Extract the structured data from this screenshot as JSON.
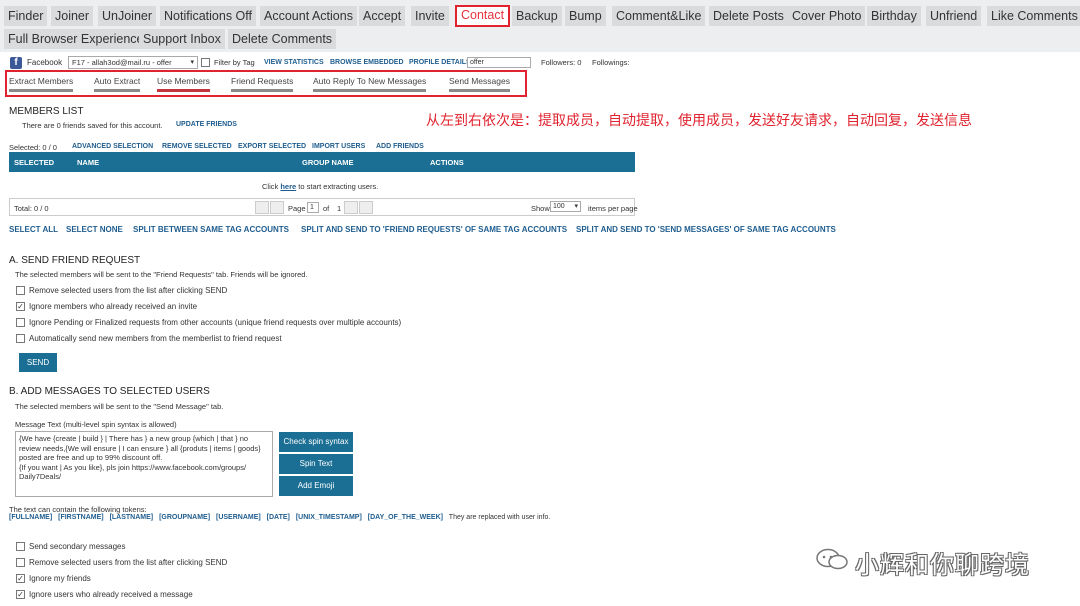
{
  "top_tabs": [
    {
      "label": "Finder"
    },
    {
      "label": "Joiner"
    },
    {
      "label": "UnJoiner"
    },
    {
      "label": "Notifications Off"
    },
    {
      "label": "Account Actions"
    },
    {
      "label": "Accept"
    },
    {
      "label": "Invite"
    },
    {
      "label": "Contact",
      "active": true
    },
    {
      "label": "Backup"
    },
    {
      "label": "Bump"
    },
    {
      "label": "Comment&Like"
    },
    {
      "label": "Delete Posts"
    },
    {
      "label": "Cover Photo"
    },
    {
      "label": "Birthday"
    },
    {
      "label": "Unfriend"
    },
    {
      "label": "Like Comments"
    },
    {
      "label": "Full Browser Experience"
    },
    {
      "label": "Support Inbox"
    },
    {
      "label": "Delete Comments"
    }
  ],
  "account": {
    "platform": "Facebook",
    "selected": "F17 - allah3od@mail.ru - offer",
    "filter_by_tag": "Filter by Tag",
    "view_statistics": "VIEW STATISTICS",
    "browse_embedded": "BROWSE EMBEDDED",
    "profile_details": "PROFILE DETAILS",
    "profile_value": "offer",
    "followers": "Followers: 0",
    "followings": "Followings:"
  },
  "sub_tabs": [
    "Extract Members",
    "Auto Extract",
    "Use Members",
    "Friend Requests",
    "Auto Reply To New Messages",
    "Send Messages"
  ],
  "annotation": "从左到右依次是：提取成员，自动提取，使用成员，发送好友请求，自动回复，发送信息",
  "members": {
    "title": "MEMBERS LIST",
    "saved_text": "There are 0 friends saved for this account.",
    "update": "UPDATE FRIENDS",
    "selected": "Selected: 0 / 0",
    "actions": [
      "ADVANCED SELECTION",
      "REMOVE SELECTED",
      "EXPORT SELECTED",
      "IMPORT USERS",
      "ADD FRIENDS"
    ],
    "columns": [
      "SELECTED",
      "NAME",
      "GROUP NAME",
      "ACTIONS"
    ],
    "click": "Click",
    "here": "here",
    "to_start": "to start extracting users.",
    "total": "Total:  0  /  0",
    "page": "Page",
    "page_value": "1",
    "of": "of",
    "pages": "1",
    "show": "Show",
    "show_value": "100",
    "per_page": "items per page"
  },
  "bulk_links": [
    "SELECT ALL",
    "SELECT NONE",
    "SPLIT BETWEEN SAME TAG ACCOUNTS",
    "SPLIT AND SEND TO 'FRIEND REQUESTS' OF SAME TAG ACCOUNTS",
    "SPLIT AND SEND TO 'SEND MESSAGES' OF SAME TAG ACCOUNTS"
  ],
  "section_a": {
    "title": "A. SEND FRIEND REQUEST",
    "desc": "The selected members will be sent to the \"Friend Requests\" tab. Friends will be ignored.",
    "options": [
      {
        "label": "Remove selected users from the list after clicking SEND",
        "checked": false
      },
      {
        "label": "Ignore members who already received an invite",
        "checked": true
      },
      {
        "label": "Ignore Pending or Finalized requests from other accounts (unique friend requests over multiple accounts)",
        "checked": false
      },
      {
        "label": "Automatically send new members from the memberlist to friend request",
        "checked": false
      }
    ],
    "send": "SEND"
  },
  "section_b": {
    "title": "B. ADD MESSAGES TO SELECTED USERS",
    "desc": "The selected members will be sent to the \"Send Message\" tab.",
    "message_label": "Message Text  (multi-level spin syntax is allowed)",
    "message_lines": [
      "{We have {create | build } | There has } a new group {which | that } no",
      "review needs,{We will ensure | I can ensure } all {produts | items | goods}",
      "posted are free and up to 99% discount off.",
      "{If you want | As you like}, pls join https://www.facebook.com/groups/",
      "Daily7Deals/"
    ],
    "buttons": [
      "Check spin syntax",
      "Spin Text",
      "Add Emoji"
    ],
    "tokens_label": "The text can contain the following tokens:",
    "tokens": [
      "[FULLNAME]",
      "[FIRSTNAME]",
      "[LASTNAME]",
      "[GROUPNAME]",
      "[USERNAME]",
      "[DATE]",
      "[UNIX_TIMESTAMP]",
      "[DAY_OF_THE_WEEK]"
    ],
    "tokens_note": "They are replaced with user info.",
    "options": [
      {
        "label": "Send secondary messages",
        "checked": false
      },
      {
        "label": "Remove selected users from the list after clicking SEND",
        "checked": false
      },
      {
        "label": "Ignore my friends",
        "checked": true
      },
      {
        "label": "Ignore users who already received a message",
        "checked": true
      }
    ]
  },
  "watermark": "小辉和你聊跨境",
  "colors": {
    "accent": "#1b6f94",
    "highlight": "#e0232e",
    "link": "#1f5d8f"
  }
}
